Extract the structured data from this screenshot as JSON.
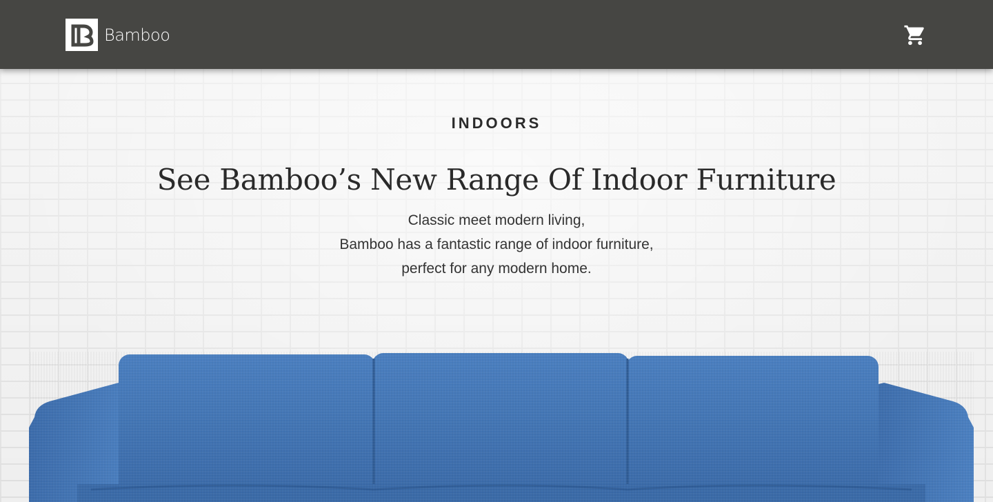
{
  "header": {
    "brand_name": "Bamboo",
    "logo_icon": "bamboo-b-logo-icon",
    "cart_icon": "shopping-cart-icon"
  },
  "hero": {
    "kicker": "INDOORS",
    "headline": "See Bamboo’s New Range Of Indoor Furniture",
    "description_lines": [
      "Classic meet modern living,",
      "Bamboo has a fantastic range of indoor furniture,",
      "perfect for any modern home."
    ]
  },
  "colors": {
    "header_bg": "#464643",
    "sofa_blue": "#3f73b3",
    "text_dark": "#2a2a2a"
  }
}
